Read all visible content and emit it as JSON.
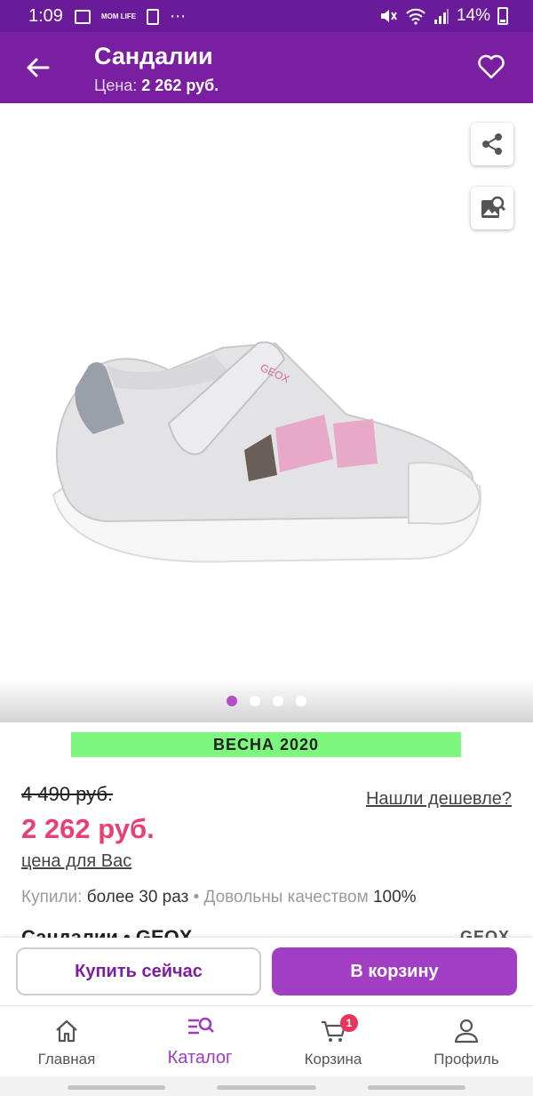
{
  "status_bar": {
    "time": "1:09",
    "more": "⋯",
    "app_icon_text": "MOM LIFE",
    "battery": "14%"
  },
  "app_bar": {
    "title": "Сандалии",
    "price_label": "Цена:",
    "price_value": "2 262 руб."
  },
  "gallery": {
    "image_count": 4,
    "active_index": 0,
    "logo_text": "GEOX",
    "accent_colors": {
      "active_dot": "#b14fc5",
      "inactive_dot": "#ffffff"
    }
  },
  "product": {
    "season_banner": "ВЕСНА 2020",
    "old_price": "4 490 руб.",
    "new_price": "2 262 руб.",
    "price_note": "цена для Вас",
    "cheaper_link": "Нашли дешевле?",
    "bought_label": "Купили:",
    "bought_value": "более 30 раз",
    "separator": "•",
    "quality_label": "Довольны качеством",
    "quality_value": "100%",
    "title_partial": "Сандалии • GEOX",
    "brand": "GEOX"
  },
  "actions": {
    "buy_now": "Купить сейчас",
    "add_to_cart": "В корзину"
  },
  "bottom_nav": {
    "items": [
      {
        "label": "Главная",
        "icon": "home-icon",
        "active": false
      },
      {
        "label": "Каталог",
        "icon": "catalog-search-icon",
        "active": true
      },
      {
        "label": "Корзина",
        "icon": "cart-icon",
        "active": false
      },
      {
        "label": "Профиль",
        "icon": "profile-icon",
        "active": false
      }
    ],
    "cart_badge": "1"
  },
  "colors": {
    "brand_purple": "#7b1fa2",
    "status_purple": "#6a1b9a",
    "button_purple": "#a23ec4",
    "price_pink": "#e84070",
    "season_green": "#7ef77e"
  }
}
